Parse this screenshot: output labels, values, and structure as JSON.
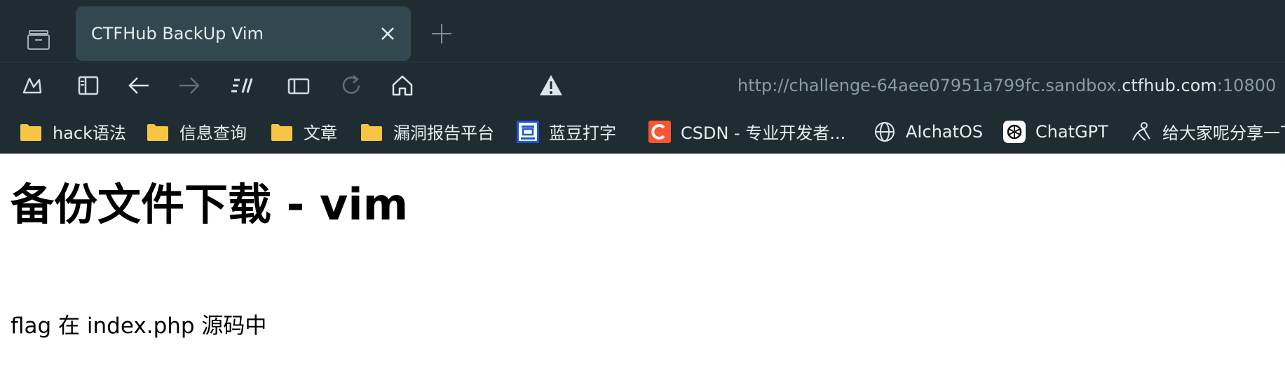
{
  "browser": {
    "tab": {
      "title": "CTFHub BackUp Vim"
    },
    "address_bar": {
      "url_prefix": "http://challenge-64aee07951a799fc.sandbox.",
      "url_host": "ctfhub.com",
      "url_suffix": ":10800"
    },
    "bookmarks": [
      {
        "label": "hack语法",
        "icon": "folder-icon"
      },
      {
        "label": "信息查询",
        "icon": "folder-icon"
      },
      {
        "label": "文章",
        "icon": "folder-icon"
      },
      {
        "label": "漏洞报告平台",
        "icon": "folder-icon"
      },
      {
        "label": "蓝豆打字",
        "icon": "landou-icon"
      },
      {
        "label": "CSDN - 专业开发者...",
        "icon": "csdn-icon"
      },
      {
        "label": "AIchatOS",
        "icon": "globe-icon"
      },
      {
        "label": "ChatGPT",
        "icon": "chatgpt-icon"
      },
      {
        "label": "给大家呢分享一下",
        "icon": "share-icon"
      }
    ],
    "colors": {
      "chrome": "#1f2d33",
      "active_tab": "#32474f",
      "url_host": "#dce6ea",
      "url_dim": "#8a9ba2",
      "csdn": "#fc5531",
      "landou": "#1a56db",
      "folder": "#f6c544"
    }
  },
  "page": {
    "title": "备份文件下载 - vim",
    "text": "flag 在 index.php 源码中"
  }
}
